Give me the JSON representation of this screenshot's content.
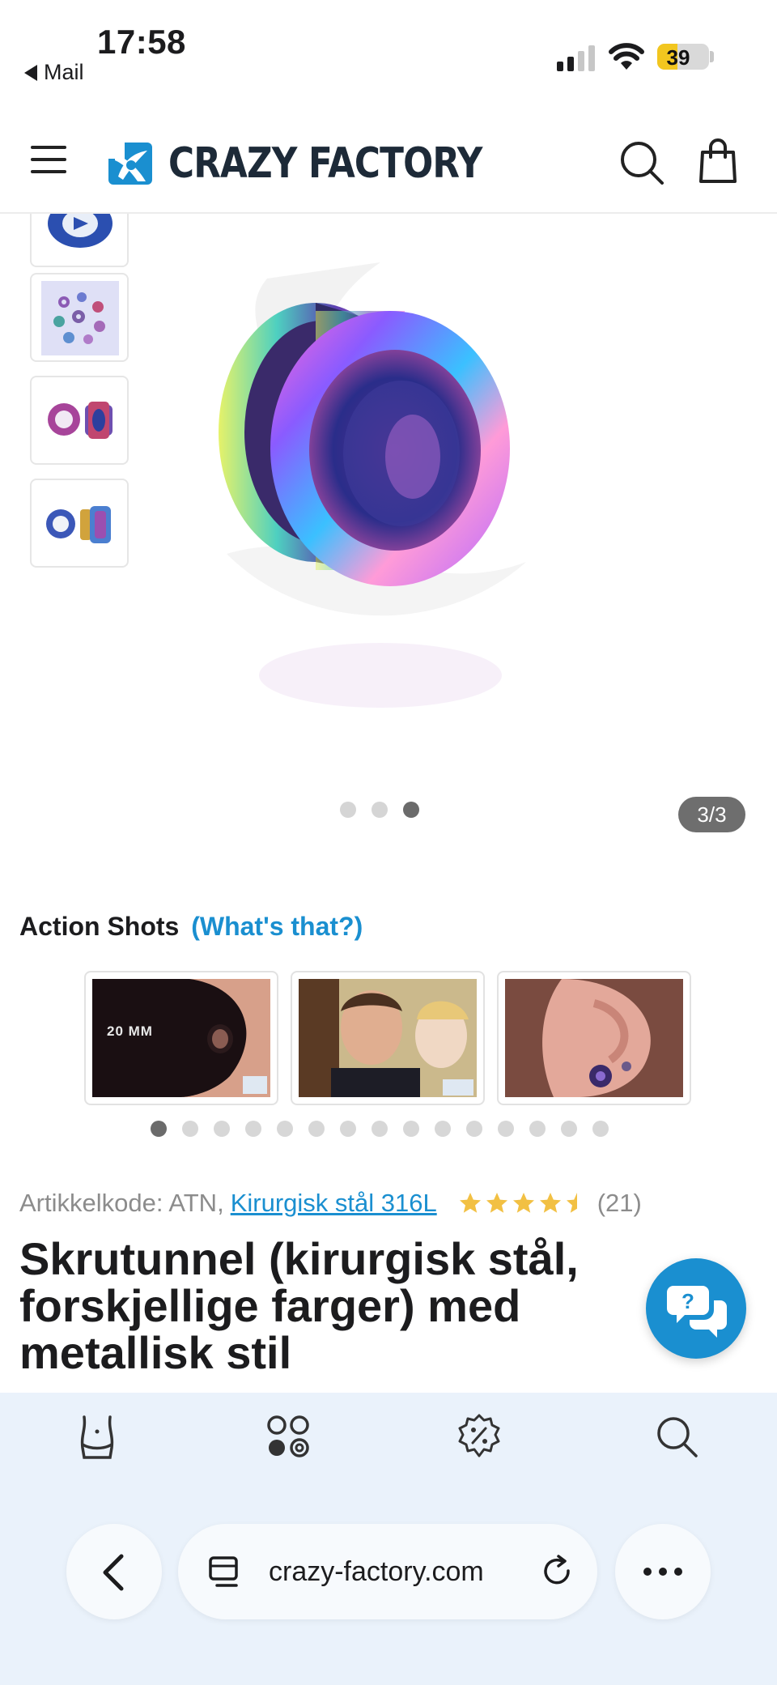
{
  "status_bar": {
    "time": "17:58",
    "back_app": "Mail",
    "battery_level": "39",
    "battery_fraction": 0.39,
    "battery_color": "#f2c61f"
  },
  "header": {
    "brand": "CRAZY FACTORY",
    "brand_color": "#1d2a38",
    "accent_color": "#1a8fd0",
    "menu_icon": "hamburger-icon",
    "search_icon": "search-icon",
    "cart_icon": "shopping-bag-icon"
  },
  "gallery": {
    "thumbnails": [
      {
        "alt": "tunnel-blue-thumbnail"
      },
      {
        "alt": "tunnels-set-thumbnail"
      },
      {
        "alt": "tunnel-pair-thumbnail"
      },
      {
        "alt": "tunnel-pair-side-thumbnail"
      }
    ],
    "main_image": "rainbow-screw-tunnel",
    "slide_count": 3,
    "active_slide": 3,
    "counter": "3/3"
  },
  "action_shots": {
    "title": "Action Shots",
    "link_label": "(What's that?)",
    "shots": [
      {
        "label": "20 MM"
      },
      {
        "label": ""
      },
      {
        "label": ""
      }
    ],
    "dot_count": 15,
    "active_dot": 1
  },
  "product": {
    "code_label": "Artikkelkode: ATN,",
    "material_link": "Kirurgisk stål 316L",
    "rating": 4.5,
    "rating_max": 5,
    "rating_count": "(21)",
    "star_color": "#f2c043",
    "title": "Skrutunnel (kirurgisk stål, forskjellige farger) med metallisk stil"
  },
  "chat": {
    "icon": "chat-bubbles-icon"
  },
  "bottom_nav": {
    "items": [
      {
        "icon": "body-icon"
      },
      {
        "icon": "jewelry-categories-icon"
      },
      {
        "icon": "sale-percent-icon"
      },
      {
        "icon": "search-icon"
      }
    ]
  },
  "safari": {
    "url": "crazy-factory.com",
    "back_icon": "chevron-left-icon",
    "tabs_icon": "reader-icon",
    "reload_icon": "reload-icon",
    "more_icon": "more-icon"
  }
}
